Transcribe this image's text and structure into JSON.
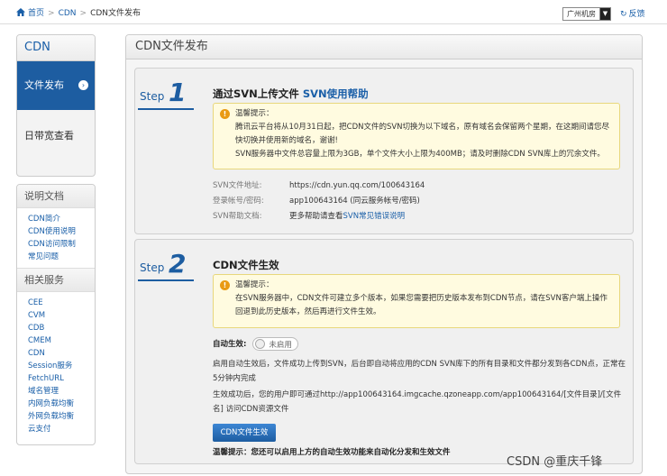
{
  "breadcrumb": {
    "home": "首页",
    "cdn": "CDN",
    "current": "CDN文件发布"
  },
  "region": {
    "selected": "广州机房",
    "back": "反馈"
  },
  "sidebar": {
    "title": "CDN",
    "active_item": "文件发布",
    "item2": "日带宽查看"
  },
  "docs": {
    "title": "说明文档",
    "items": [
      "CDN简介",
      "CDN使用说明",
      "CDN访问限制",
      "常见问题"
    ]
  },
  "services": {
    "title": "相关服务",
    "items": [
      "CEE",
      "CVM",
      "CDB",
      "CMEM",
      "CDN",
      "Session服务",
      "FetchURL",
      "域名管理",
      "内网负载均衡",
      "外网负载均衡",
      "云支付"
    ]
  },
  "main": {
    "title": "CDN文件发布",
    "step1": {
      "word": "Step",
      "num": "1",
      "heading": "通过SVN上传文件",
      "help": "SVN使用帮助",
      "tip_title": "温馨提示：",
      "tip_line1": "腾讯云平台将从10月31日起，把CDN文件的SVN切换为以下域名，原有域名会保留两个星期，在这期间请您尽快切换并使用新的域名，谢谢!",
      "tip_line2": "SVN服务器中文件总容量上限为3GB，单个文件大小上限为400MB；请及时删除CDN SVN库上的冗余文件。",
      "svn_addr_label": "SVN文件地址:",
      "svn_addr": "https://cdn.yun.qq.com/100643164",
      "account_label": "登录帐号/密码:",
      "account": "app100643164 (同云服务帐号/密码)",
      "doc_label": "SVN帮助文档:",
      "doc_prefix": "更多帮助请查看",
      "doc_link": "SVN常见错误说明"
    },
    "step2": {
      "word": "Step",
      "num": "2",
      "heading": "CDN文件生效",
      "tip_title": "温馨提示：",
      "tip_line1": "在SVN服务器中，CDN文件可建立多个版本，如果您需要把历史版本发布到CDN节点，请在SVN客户端上操作回退到此历史版本，然后再进行文件生效。",
      "auto_label": "自动生效:",
      "auto_state": "未启用",
      "para1": "启用自动生效后，文件成功上传到SVN，后台即自动将应用的CDN SVN库下的所有目录和文件都分发到各CDN点，正常在5分钟内完成",
      "para2": "生效成功后，您的用户即可通过http://app100643164.imgcache.qzoneapp.com/app100643164/[文件目录]/[文件名] 访问CDN资源文件",
      "button": "CDN文件生效",
      "bottom_tip": "温馨提示：您还可以启用上方的自动生效功能来自动化分发和生效文件"
    }
  },
  "watermark": "CSDN @重庆千锋",
  "colors": {
    "brand": "#1d5da1",
    "link": "#1a5fa8",
    "tip_bg": "#fffbe0",
    "warn": "#e99a14"
  }
}
